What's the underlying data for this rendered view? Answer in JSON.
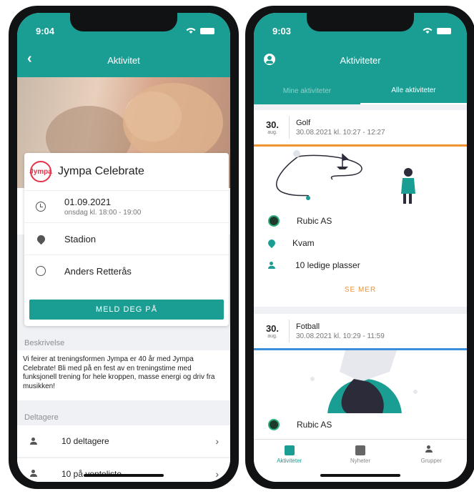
{
  "left": {
    "status_time": "9:04",
    "title": "Aktivitet",
    "event": {
      "logo_text": "Jympa",
      "name": "Jympa Celebrate",
      "date": "01.09.2021",
      "time": "onsdag kl. 18:00 - 19:00",
      "location": "Stadion",
      "instructor": "Anders Retterås",
      "signup_label": "MELD DEG PÅ"
    },
    "description_header": "Beskrivelse",
    "description": "Vi feirer at treningsformen Jympa er 40 år med Jympa Celebrate! Bli med på en fest av en treningstime med funksjonell trening for hele kroppen, masse energi og driv fra musikken!",
    "participants_header": "Deltagere",
    "participants": "10 deltagere",
    "waitlist": "10 på venteliste"
  },
  "right": {
    "status_time": "9:03",
    "title": "Aktiviteter",
    "tabs": [
      "Mine aktiviteter",
      "Alle aktiviteter"
    ],
    "activities": [
      {
        "day": "30.",
        "month": "aug.",
        "title": "Golf",
        "time": "30.08.2021 kl. 10:27 - 12:27",
        "accent": "#f0922e",
        "club": "Rubic AS",
        "location": "Kvam",
        "spots": "10 ledige plasser",
        "see_more": "SE MER"
      },
      {
        "day": "30.",
        "month": "aug.",
        "title": "Fotball",
        "time": "30.08.2021 kl. 10:29 - 11:59",
        "accent": "#3a8fd8",
        "club": "Rubic AS"
      }
    ],
    "bottom_tabs": [
      "Aktiviteter",
      "Nyheter",
      "Grupper"
    ]
  },
  "colors": {
    "primary": "#1a9e93",
    "accent_orange": "#f0922e",
    "accent_blue": "#3a8fd8",
    "logo_red": "#e3344b"
  },
  "icons": [
    "back-arrow-icon",
    "clock-icon",
    "location-pin-icon",
    "face-icon",
    "people-icon",
    "people-clock-icon",
    "chevron-right-icon",
    "account-icon",
    "calendar-icon",
    "news-icon",
    "groups-icon",
    "wifi-icon",
    "battery-icon"
  ]
}
